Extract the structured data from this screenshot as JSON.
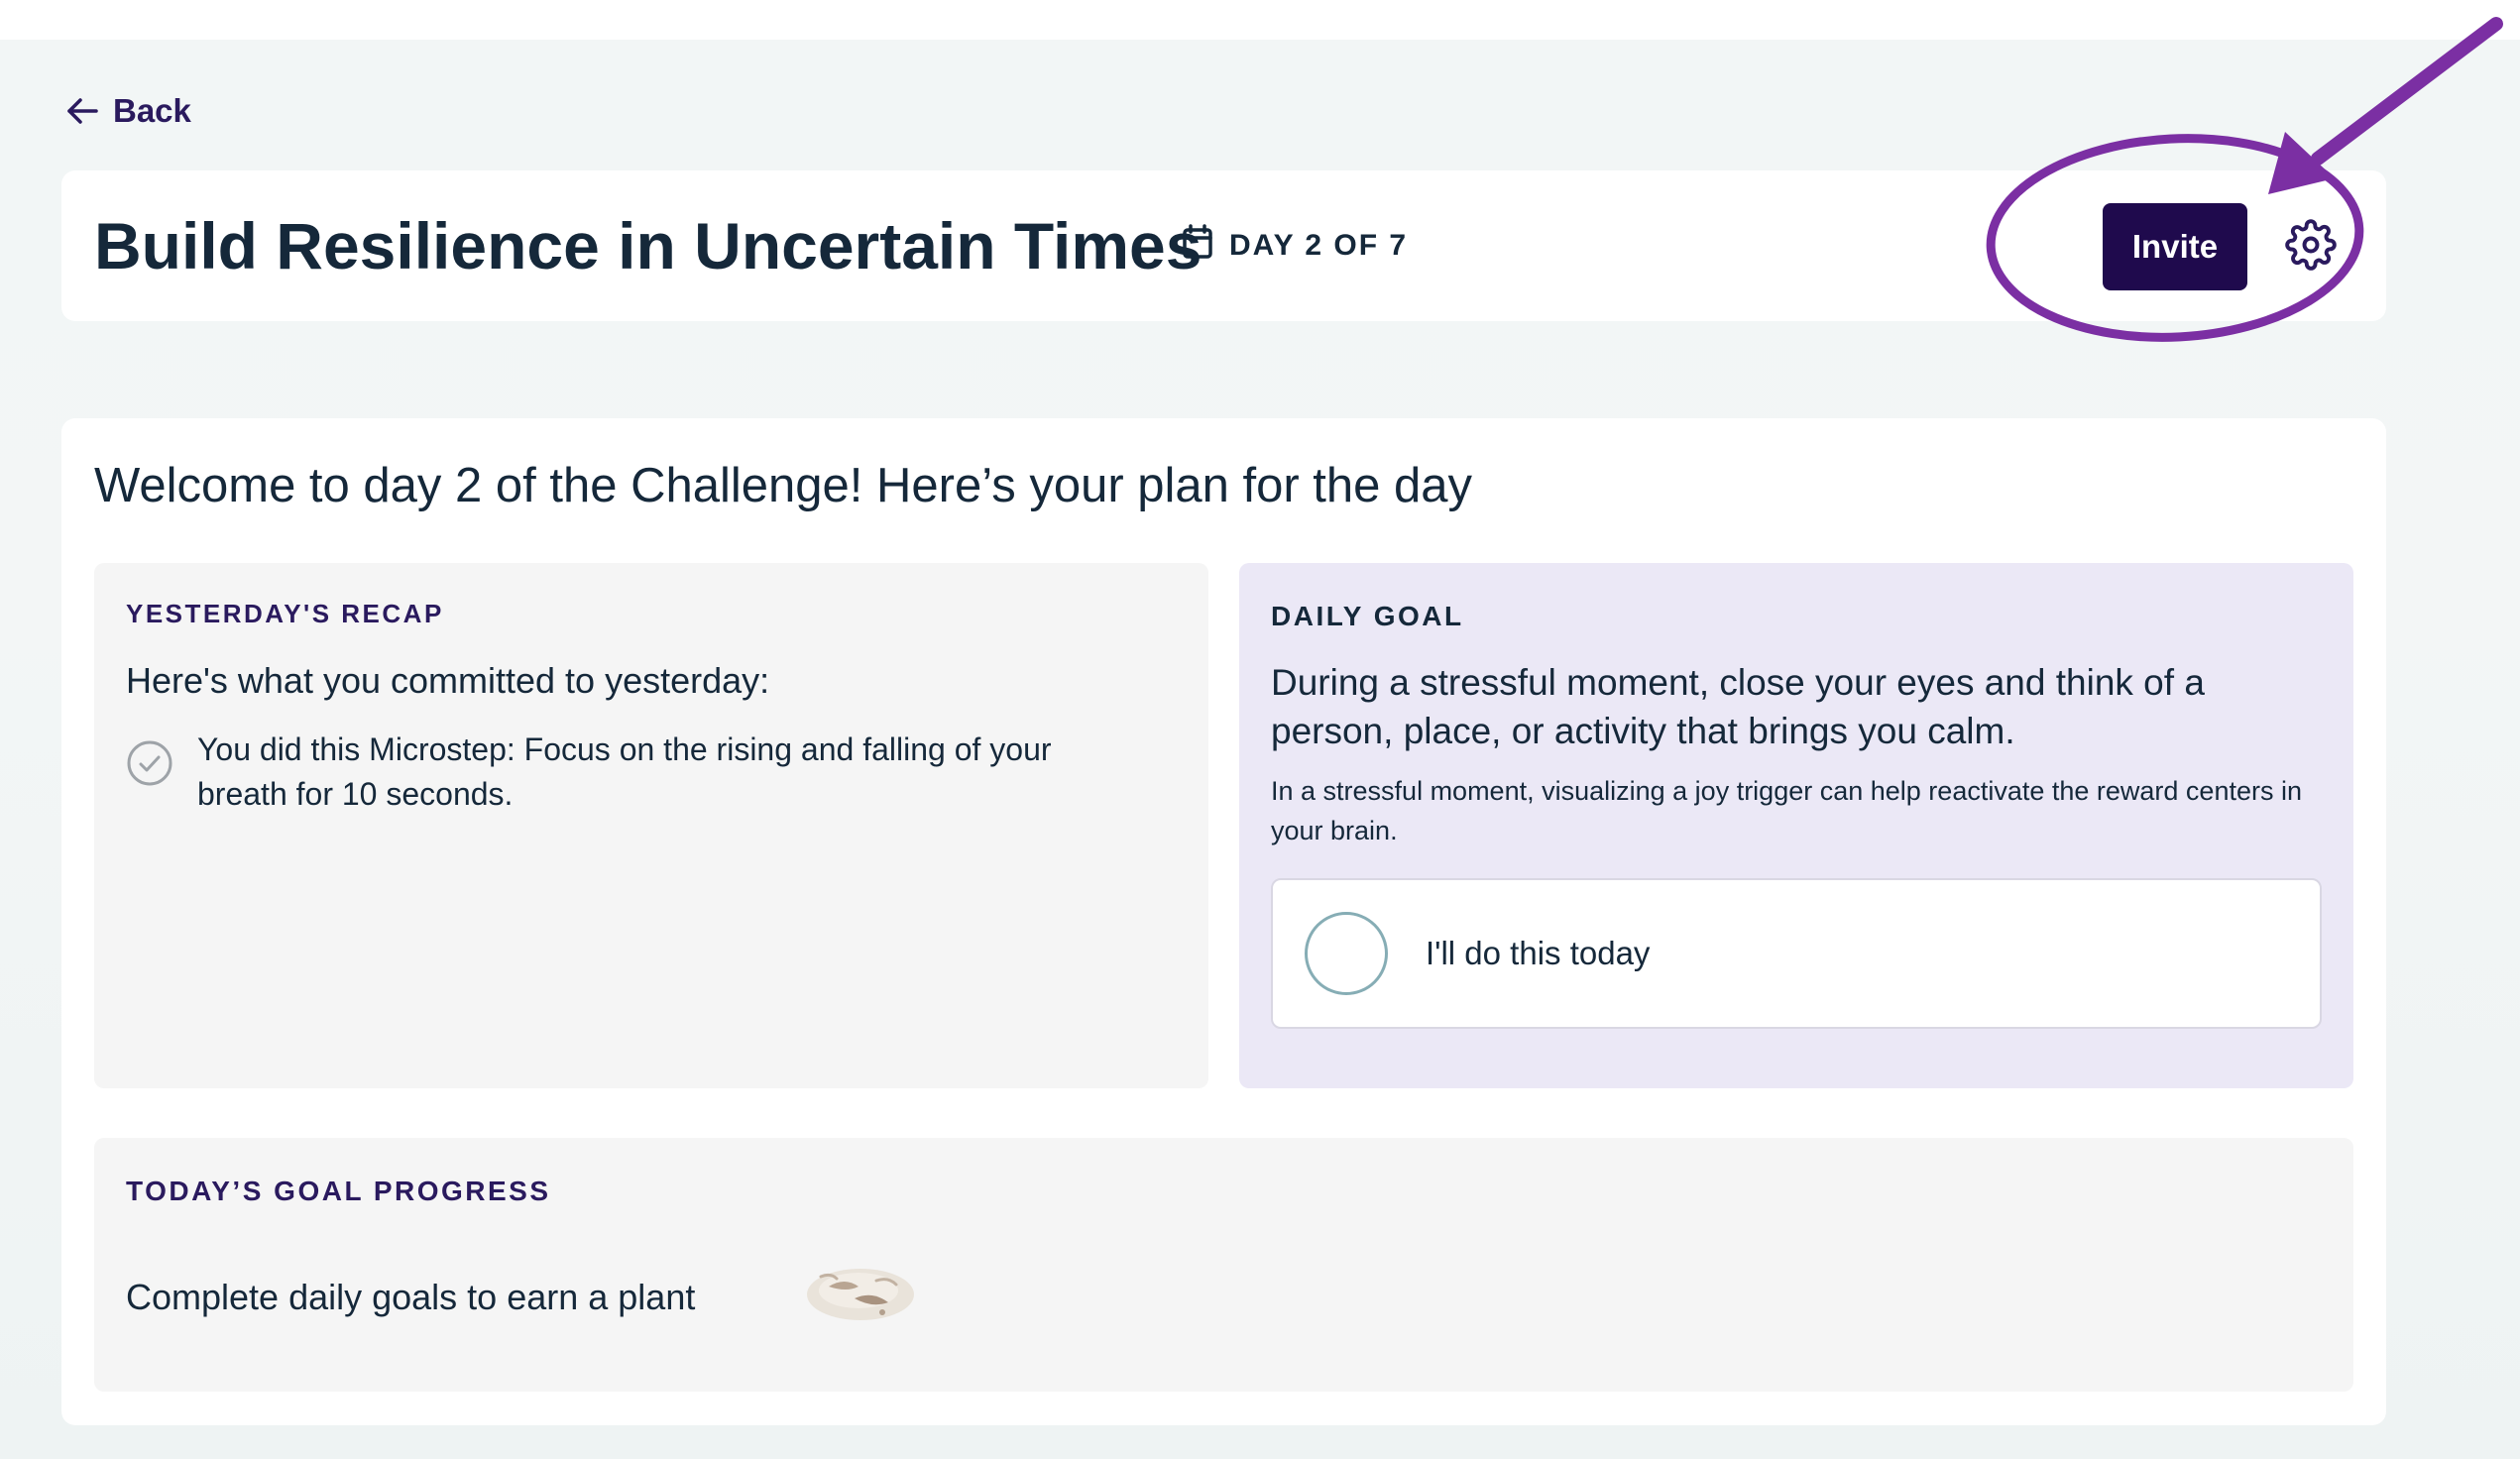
{
  "nav": {
    "back_label": "Back"
  },
  "header": {
    "title": "Build Resilience in Uncertain Times",
    "day_badge": "DAY 2 OF 7",
    "invite_label": "Invite",
    "icons": [
      "arrow-left-icon",
      "calendar-icon",
      "gear-icon"
    ]
  },
  "main": {
    "welcome": "Welcome to day 2 of the Challenge! Here’s your plan for the day",
    "recap": {
      "label": "YESTERDAY'S RECAP",
      "intro": "Here's what you committed to yesterday:",
      "item": "You did this Microstep: Focus on the rising and falling of your breath for 10 seconds.",
      "item_icon": "check-circle-icon"
    },
    "goal": {
      "label": "DAILY GOAL",
      "title": "During a stressful moment, close your eyes and think of a person, place, or activity that brings you calm.",
      "description": "In a stressful moment, visualizing a joy trigger can help reactivate the reward centers in your brain.",
      "commit_label": "I'll do this today",
      "commit_checked": false
    },
    "progress": {
      "label": "TODAY’S GOAL PROGRESS",
      "text": "Complete daily goals to earn a plant",
      "icon": "plant-seed-icon"
    }
  },
  "colors": {
    "brand_dark": "#1f0a4d",
    "label_purple": "#2a1a5e",
    "goal_panel_bg": "#ebe8f6",
    "annotation_purple": "#7b2fa3",
    "commit_circle": "#86adb5"
  }
}
